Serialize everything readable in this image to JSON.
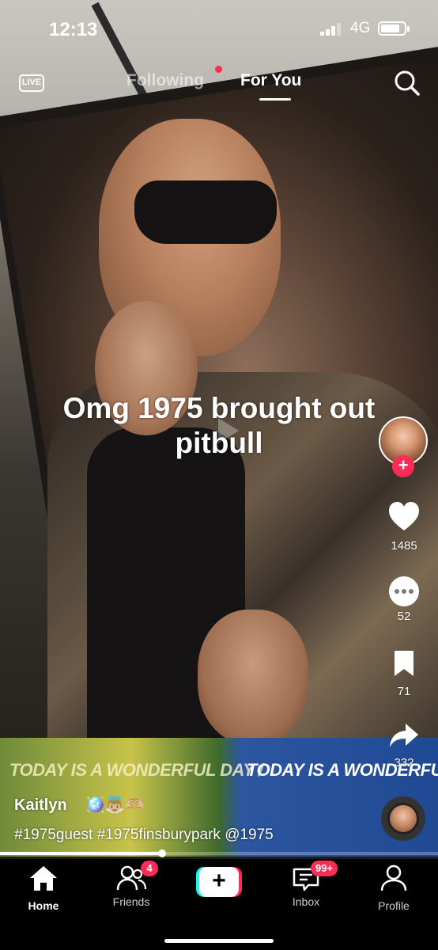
{
  "status_bar": {
    "time": "12:13",
    "network": "4G",
    "battery_level": 0.85
  },
  "top_nav": {
    "live_label": "LIVE",
    "tabs": [
      {
        "label": "Following",
        "active": false,
        "has_dot": true
      },
      {
        "label": "For You",
        "active": true
      }
    ]
  },
  "video": {
    "caption_line1": "Omg 1975 brought out",
    "caption_line2": "pitbull",
    "banner_left": "TODAY IS A WONDERFUL DAY /",
    "banner_right": "TODAY IS A WONDERFUL"
  },
  "actions": {
    "likes": "1485",
    "comments": "52",
    "bookmarks": "71",
    "shares": "332"
  },
  "post": {
    "author": "Kaitlyn",
    "author_emoji": "🪩👼🏼🫶🏼",
    "hashtags": "#1975guest #1975finsburypark @1975",
    "progress": 0.37
  },
  "tab_bar": {
    "home": "Home",
    "friends": "Friends",
    "friends_badge": "4",
    "create": "+",
    "inbox": "Inbox",
    "inbox_badge": "99+",
    "profile": "Profile"
  },
  "colors": {
    "accent": "#fe2c55",
    "cyan": "#25f4ee"
  }
}
